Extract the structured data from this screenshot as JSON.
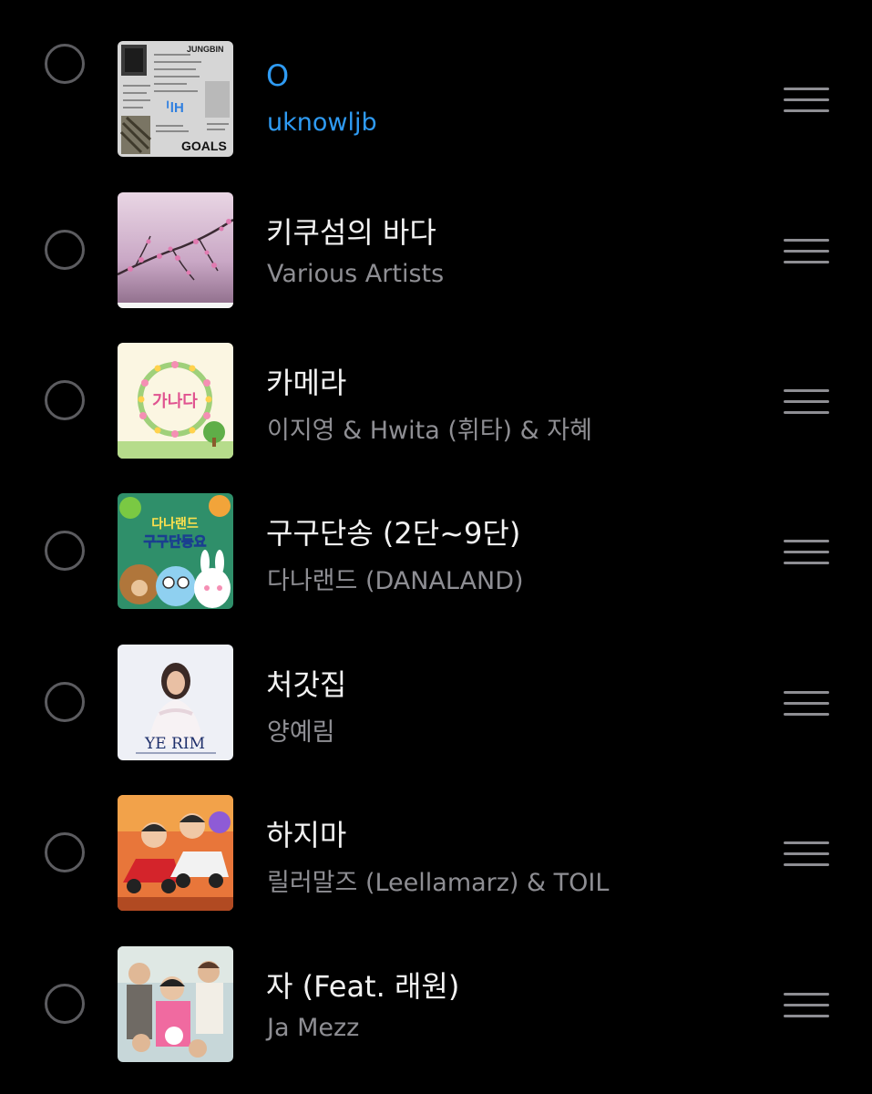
{
  "playlist": {
    "tracks": [
      {
        "title": "O",
        "artist": "uknowljb",
        "art_icon": "jungbin-goals-album-art",
        "now_playing": true
      },
      {
        "title": "키쿠섬의 바다",
        "artist": "Various Artists",
        "art_icon": "pink-blossom-branch-album-art",
        "now_playing": false
      },
      {
        "title": "카메라",
        "artist": "이지영 & Hwita (휘타) & 자혜",
        "art_icon": "ganada-flower-wreath-album-art",
        "art_text": "가나다",
        "now_playing": false
      },
      {
        "title": "구구단송 (2단~9단)",
        "artist": "다나랜드 (DANALAND)",
        "art_icon": "danaland-animals-album-art",
        "art_text_1": "다나랜드",
        "art_text_2": "구구단동요",
        "now_playing": false
      },
      {
        "title": "처갓집",
        "artist": "양예림",
        "art_icon": "yerim-portrait-album-art",
        "art_text": "YE RIM",
        "now_playing": false
      },
      {
        "title": "하지마",
        "artist": "릴러말즈 (Leellamarz) & TOIL",
        "art_icon": "kids-in-toy-cars-album-art",
        "now_playing": false
      },
      {
        "title": "자 (Feat. 래원)",
        "artist": "Ja Mezz",
        "art_icon": "family-photo-album-art",
        "now_playing": false
      }
    ]
  },
  "colors": {
    "background": "#000000",
    "now_playing_accent": "#2f9bf3",
    "title": "#f2f2f2",
    "artist": "#8e8e93"
  }
}
